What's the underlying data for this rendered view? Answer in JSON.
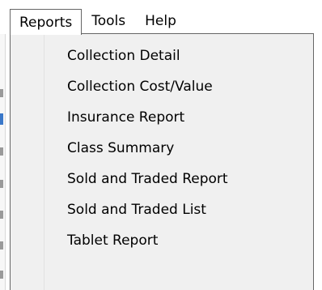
{
  "menubar": {
    "items": [
      {
        "label": "Reports"
      },
      {
        "label": "Tools"
      },
      {
        "label": "Help"
      }
    ]
  },
  "reports_menu": {
    "items": [
      {
        "label": "Collection Detail"
      },
      {
        "label": "Collection Cost/Value"
      },
      {
        "label": "Insurance Report"
      },
      {
        "label": "Class Summary"
      },
      {
        "label": "Sold and Traded Report"
      },
      {
        "label": "Sold and Traded List"
      },
      {
        "label": "Tablet Report"
      }
    ]
  }
}
